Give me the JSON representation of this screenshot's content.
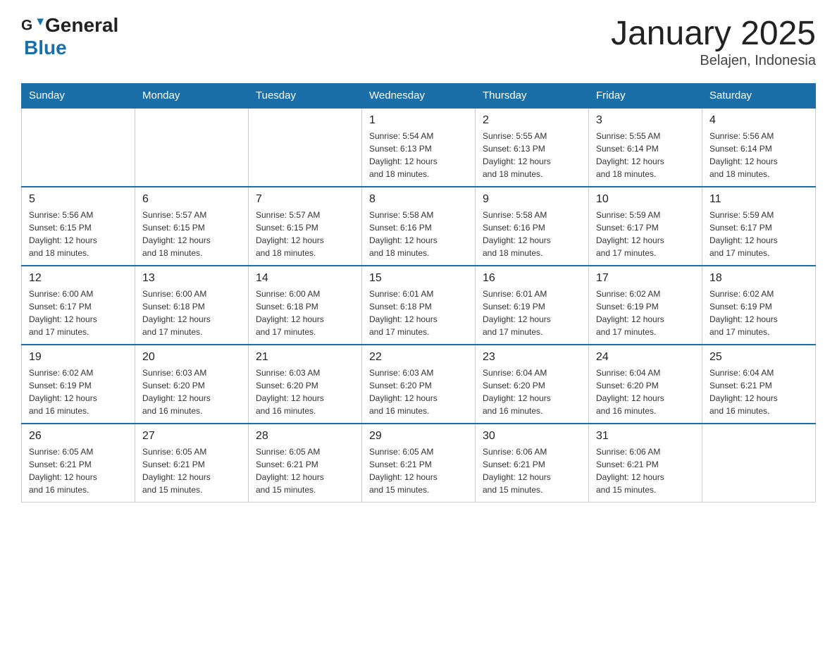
{
  "header": {
    "logo_general": "General",
    "logo_blue": "Blue",
    "title": "January 2025",
    "subtitle": "Belajen, Indonesia"
  },
  "days_of_week": [
    "Sunday",
    "Monday",
    "Tuesday",
    "Wednesday",
    "Thursday",
    "Friday",
    "Saturday"
  ],
  "weeks": [
    [
      {
        "day": "",
        "info": ""
      },
      {
        "day": "",
        "info": ""
      },
      {
        "day": "",
        "info": ""
      },
      {
        "day": "1",
        "info": "Sunrise: 5:54 AM\nSunset: 6:13 PM\nDaylight: 12 hours\nand 18 minutes."
      },
      {
        "day": "2",
        "info": "Sunrise: 5:55 AM\nSunset: 6:13 PM\nDaylight: 12 hours\nand 18 minutes."
      },
      {
        "day": "3",
        "info": "Sunrise: 5:55 AM\nSunset: 6:14 PM\nDaylight: 12 hours\nand 18 minutes."
      },
      {
        "day": "4",
        "info": "Sunrise: 5:56 AM\nSunset: 6:14 PM\nDaylight: 12 hours\nand 18 minutes."
      }
    ],
    [
      {
        "day": "5",
        "info": "Sunrise: 5:56 AM\nSunset: 6:15 PM\nDaylight: 12 hours\nand 18 minutes."
      },
      {
        "day": "6",
        "info": "Sunrise: 5:57 AM\nSunset: 6:15 PM\nDaylight: 12 hours\nand 18 minutes."
      },
      {
        "day": "7",
        "info": "Sunrise: 5:57 AM\nSunset: 6:15 PM\nDaylight: 12 hours\nand 18 minutes."
      },
      {
        "day": "8",
        "info": "Sunrise: 5:58 AM\nSunset: 6:16 PM\nDaylight: 12 hours\nand 18 minutes."
      },
      {
        "day": "9",
        "info": "Sunrise: 5:58 AM\nSunset: 6:16 PM\nDaylight: 12 hours\nand 18 minutes."
      },
      {
        "day": "10",
        "info": "Sunrise: 5:59 AM\nSunset: 6:17 PM\nDaylight: 12 hours\nand 17 minutes."
      },
      {
        "day": "11",
        "info": "Sunrise: 5:59 AM\nSunset: 6:17 PM\nDaylight: 12 hours\nand 17 minutes."
      }
    ],
    [
      {
        "day": "12",
        "info": "Sunrise: 6:00 AM\nSunset: 6:17 PM\nDaylight: 12 hours\nand 17 minutes."
      },
      {
        "day": "13",
        "info": "Sunrise: 6:00 AM\nSunset: 6:18 PM\nDaylight: 12 hours\nand 17 minutes."
      },
      {
        "day": "14",
        "info": "Sunrise: 6:00 AM\nSunset: 6:18 PM\nDaylight: 12 hours\nand 17 minutes."
      },
      {
        "day": "15",
        "info": "Sunrise: 6:01 AM\nSunset: 6:18 PM\nDaylight: 12 hours\nand 17 minutes."
      },
      {
        "day": "16",
        "info": "Sunrise: 6:01 AM\nSunset: 6:19 PM\nDaylight: 12 hours\nand 17 minutes."
      },
      {
        "day": "17",
        "info": "Sunrise: 6:02 AM\nSunset: 6:19 PM\nDaylight: 12 hours\nand 17 minutes."
      },
      {
        "day": "18",
        "info": "Sunrise: 6:02 AM\nSunset: 6:19 PM\nDaylight: 12 hours\nand 17 minutes."
      }
    ],
    [
      {
        "day": "19",
        "info": "Sunrise: 6:02 AM\nSunset: 6:19 PM\nDaylight: 12 hours\nand 16 minutes."
      },
      {
        "day": "20",
        "info": "Sunrise: 6:03 AM\nSunset: 6:20 PM\nDaylight: 12 hours\nand 16 minutes."
      },
      {
        "day": "21",
        "info": "Sunrise: 6:03 AM\nSunset: 6:20 PM\nDaylight: 12 hours\nand 16 minutes."
      },
      {
        "day": "22",
        "info": "Sunrise: 6:03 AM\nSunset: 6:20 PM\nDaylight: 12 hours\nand 16 minutes."
      },
      {
        "day": "23",
        "info": "Sunrise: 6:04 AM\nSunset: 6:20 PM\nDaylight: 12 hours\nand 16 minutes."
      },
      {
        "day": "24",
        "info": "Sunrise: 6:04 AM\nSunset: 6:20 PM\nDaylight: 12 hours\nand 16 minutes."
      },
      {
        "day": "25",
        "info": "Sunrise: 6:04 AM\nSunset: 6:21 PM\nDaylight: 12 hours\nand 16 minutes."
      }
    ],
    [
      {
        "day": "26",
        "info": "Sunrise: 6:05 AM\nSunset: 6:21 PM\nDaylight: 12 hours\nand 16 minutes."
      },
      {
        "day": "27",
        "info": "Sunrise: 6:05 AM\nSunset: 6:21 PM\nDaylight: 12 hours\nand 15 minutes."
      },
      {
        "day": "28",
        "info": "Sunrise: 6:05 AM\nSunset: 6:21 PM\nDaylight: 12 hours\nand 15 minutes."
      },
      {
        "day": "29",
        "info": "Sunrise: 6:05 AM\nSunset: 6:21 PM\nDaylight: 12 hours\nand 15 minutes."
      },
      {
        "day": "30",
        "info": "Sunrise: 6:06 AM\nSunset: 6:21 PM\nDaylight: 12 hours\nand 15 minutes."
      },
      {
        "day": "31",
        "info": "Sunrise: 6:06 AM\nSunset: 6:21 PM\nDaylight: 12 hours\nand 15 minutes."
      },
      {
        "day": "",
        "info": ""
      }
    ]
  ]
}
